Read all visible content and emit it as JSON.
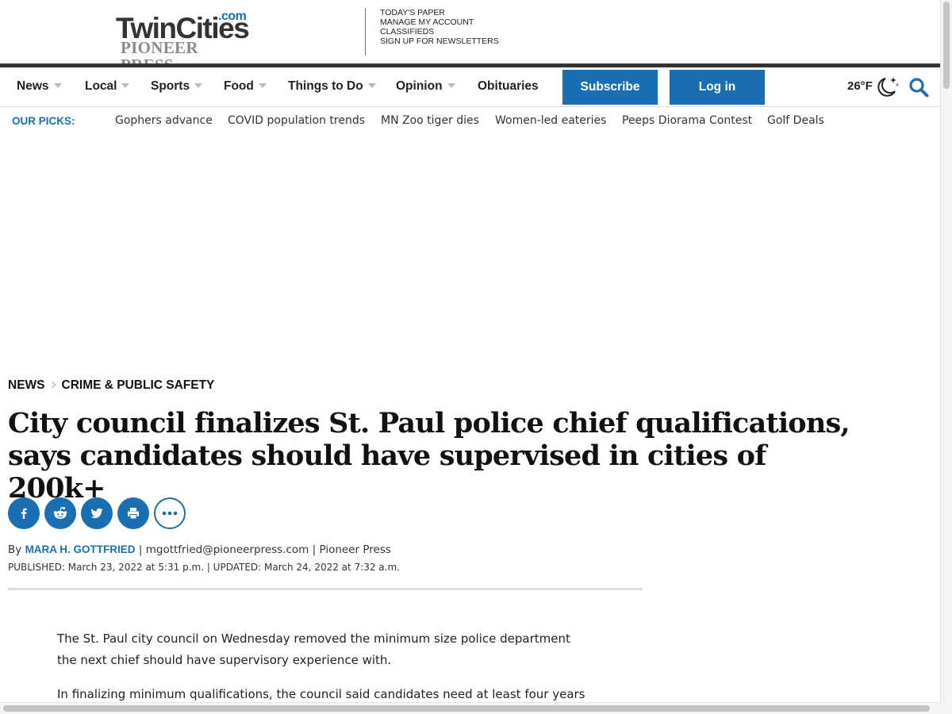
{
  "header": {
    "logo": {
      "com": ".com",
      "twincities": "TwinCities",
      "pioneer_press": "PIONEER PRESS"
    },
    "top_links": [
      "TODAY'S PAPER",
      "MANAGE MY ACCOUNT",
      "CLASSIFIEDS",
      "SIGN UP FOR NEWSLETTERS"
    ]
  },
  "nav": {
    "items": [
      {
        "label": "News",
        "has_dropdown": true
      },
      {
        "label": "Local",
        "has_dropdown": true
      },
      {
        "label": "Sports",
        "has_dropdown": true
      },
      {
        "label": "Food",
        "has_dropdown": true
      },
      {
        "label": "Things to Do",
        "has_dropdown": true
      },
      {
        "label": "Opinion",
        "has_dropdown": true
      },
      {
        "label": "Obituaries",
        "has_dropdown": false
      }
    ],
    "subscribe_label": "Subscribe",
    "login_label": "Log in",
    "weather": "26°F",
    "weather_icon": "moon-stars-icon",
    "search_icon": "search-icon"
  },
  "picks": {
    "label": "OUR PICKS:",
    "items": [
      "Gophers advance",
      "COVID population trends",
      "MN Zoo tiger dies",
      "Women-led eateries",
      "Peeps Diorama Contest",
      "Golf Deals"
    ]
  },
  "article": {
    "breadcrumb": [
      "NEWS",
      "CRIME & PUBLIC SAFETY"
    ],
    "headline": "City council finalizes St. Paul police chief qualifications, says candidates should have supervised in cities of 200k+",
    "share_icons": [
      "facebook-icon",
      "reddit-icon",
      "twitter-icon",
      "print-icon",
      "more-icon"
    ],
    "byline": {
      "by": "By",
      "author": "MARA H. GOTTFRIED",
      "email": "mgottfried@pioneerpress.com",
      "outlet": "Pioneer Press"
    },
    "published": "PUBLISHED: March 23, 2022 at 5:31 p.m. | UPDATED: March 24, 2022 at 7:32 a.m.",
    "paragraphs": [
      "The St. Paul city council on Wednesday removed the minimum size police department the next chief should have supervisory experience with.",
      "In finalizing minimum qualifications, the council said candidates need at least four years of"
    ]
  },
  "colors": {
    "brand_blue": "#1a6fb3",
    "dark_rule": "#333333"
  }
}
